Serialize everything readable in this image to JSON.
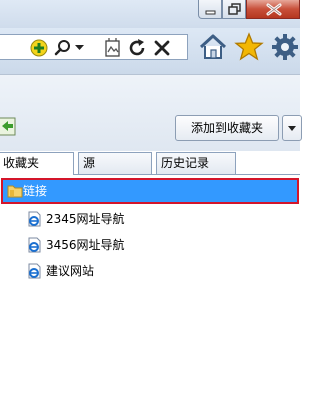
{
  "window": {
    "buttons": [
      "minimize",
      "restore",
      "close"
    ]
  },
  "toolbar": {
    "icons": [
      "add-on-icon",
      "search-icon",
      "dropdown-arrow-icon",
      "compatibility-view-icon",
      "refresh-icon",
      "stop-icon",
      "home-icon",
      "favorites-star-icon",
      "settings-gear-icon"
    ]
  },
  "favorites": {
    "add_button_label": "添加到收藏夹",
    "tabs": [
      {
        "label": "收藏夹",
        "active": true
      },
      {
        "label": "源",
        "active": false
      },
      {
        "label": "历史记录",
        "active": false
      }
    ],
    "items": [
      {
        "label": "链接",
        "type": "folder",
        "selected": true
      },
      {
        "label": "2345网址导航",
        "type": "link",
        "selected": false
      },
      {
        "label": "3456网址导航",
        "type": "link",
        "selected": false
      },
      {
        "label": "建议网站",
        "type": "link",
        "selected": false
      }
    ]
  },
  "colors": {
    "selection": "#3399ff",
    "highlight_border": "#d4152a",
    "close_button": "#c8503a"
  }
}
